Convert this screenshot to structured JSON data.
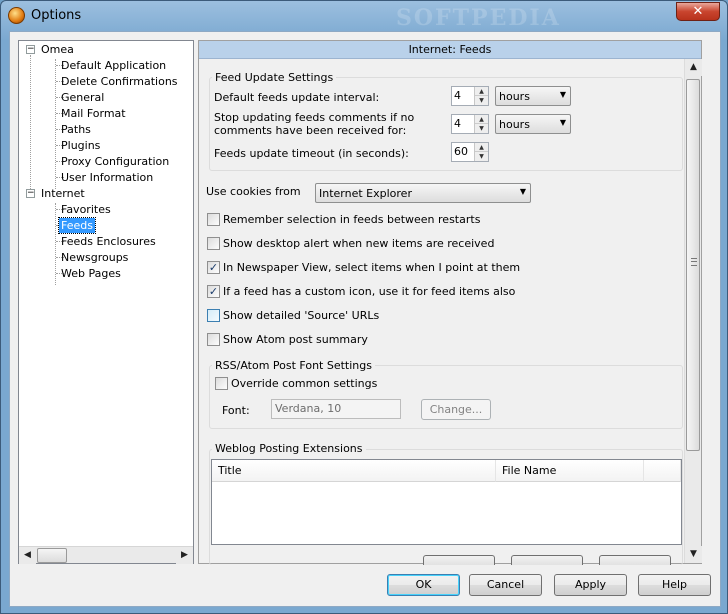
{
  "window": {
    "title": "Options",
    "watermark": "SOFTPEDIA",
    "close_glyph": "✕"
  },
  "tree": {
    "root1": "Omea",
    "root1_children": [
      "Default Application",
      "Delete Confirmations",
      "General",
      "Mail Format",
      "Paths",
      "Plugins",
      "Proxy Configuration",
      "User Information"
    ],
    "root2": "Internet",
    "root2_children": [
      "Favorites",
      "Feeds",
      "Feeds Enclosures",
      "Newsgroups",
      "Web Pages"
    ],
    "selected": "Feeds"
  },
  "panel": {
    "header": "Internet: Feeds",
    "feed_update": {
      "title": "Feed Update Settings",
      "interval_label": "Default feeds update interval:",
      "interval_value": "4",
      "interval_unit": "hours",
      "stop_label_1": "Stop updating feeds comments if no",
      "stop_label_2": "comments have been received for:",
      "stop_value": "4",
      "stop_unit": "hours",
      "timeout_label": "Feeds update timeout (in seconds):",
      "timeout_value": "60"
    },
    "cookies_label": "Use cookies from",
    "cookies_value": "Internet Explorer",
    "checkboxes": [
      {
        "label": "Remember selection in feeds between restarts",
        "checked": false
      },
      {
        "label": "Show desktop alert when new items are received",
        "checked": false
      },
      {
        "label": "In Newspaper View, select items when I point at them",
        "checked": true
      },
      {
        "label": "If a feed has a custom icon, use it for feed items also",
        "checked": true
      },
      {
        "label": "Show detailed 'Source' URLs",
        "checked": false
      },
      {
        "label": "Show Atom post summary",
        "checked": false
      }
    ],
    "font_group": {
      "title": "RSS/Atom Post Font Settings",
      "override_label": "Override common settings",
      "font_label": "Font:",
      "font_value": "Verdana, 10",
      "change_label": "Change..."
    },
    "weblog": {
      "title": "Weblog Posting Extensions",
      "columns": [
        "Title",
        "File Name"
      ]
    }
  },
  "buttons": {
    "ok": "OK",
    "cancel": "Cancel",
    "apply": "Apply",
    "help": "Help"
  }
}
